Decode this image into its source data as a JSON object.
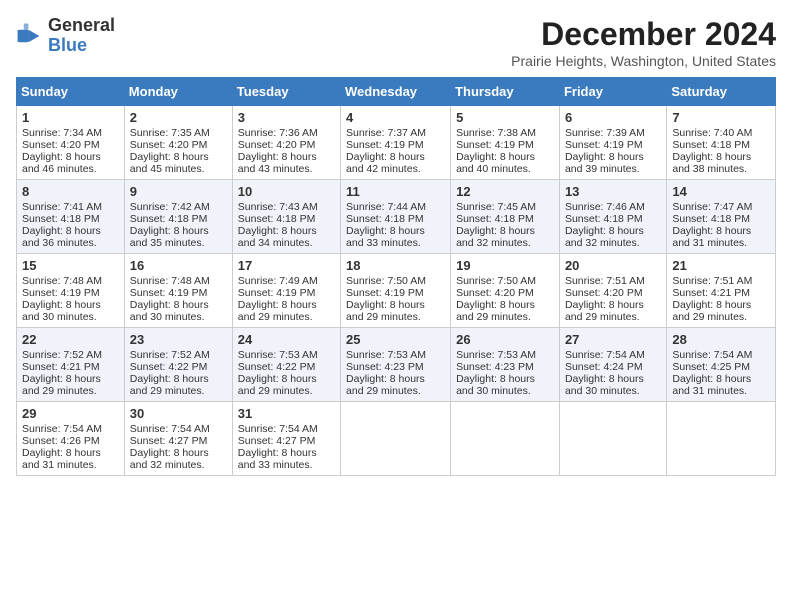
{
  "app": {
    "name_line1": "General",
    "name_line2": "Blue"
  },
  "header": {
    "month": "December 2024",
    "location": "Prairie Heights, Washington, United States"
  },
  "weekdays": [
    "Sunday",
    "Monday",
    "Tuesday",
    "Wednesday",
    "Thursday",
    "Friday",
    "Saturday"
  ],
  "weeks": [
    [
      {
        "day": 1,
        "sunrise": "7:34 AM",
        "sunset": "4:20 PM",
        "daylight": "8 hours and 46 minutes."
      },
      {
        "day": 2,
        "sunrise": "7:35 AM",
        "sunset": "4:20 PM",
        "daylight": "8 hours and 45 minutes."
      },
      {
        "day": 3,
        "sunrise": "7:36 AM",
        "sunset": "4:20 PM",
        "daylight": "8 hours and 43 minutes."
      },
      {
        "day": 4,
        "sunrise": "7:37 AM",
        "sunset": "4:19 PM",
        "daylight": "8 hours and 42 minutes."
      },
      {
        "day": 5,
        "sunrise": "7:38 AM",
        "sunset": "4:19 PM",
        "daylight": "8 hours and 40 minutes."
      },
      {
        "day": 6,
        "sunrise": "7:39 AM",
        "sunset": "4:19 PM",
        "daylight": "8 hours and 39 minutes."
      },
      {
        "day": 7,
        "sunrise": "7:40 AM",
        "sunset": "4:18 PM",
        "daylight": "8 hours and 38 minutes."
      }
    ],
    [
      {
        "day": 8,
        "sunrise": "7:41 AM",
        "sunset": "4:18 PM",
        "daylight": "8 hours and 36 minutes."
      },
      {
        "day": 9,
        "sunrise": "7:42 AM",
        "sunset": "4:18 PM",
        "daylight": "8 hours and 35 minutes."
      },
      {
        "day": 10,
        "sunrise": "7:43 AM",
        "sunset": "4:18 PM",
        "daylight": "8 hours and 34 minutes."
      },
      {
        "day": 11,
        "sunrise": "7:44 AM",
        "sunset": "4:18 PM",
        "daylight": "8 hours and 33 minutes."
      },
      {
        "day": 12,
        "sunrise": "7:45 AM",
        "sunset": "4:18 PM",
        "daylight": "8 hours and 32 minutes."
      },
      {
        "day": 13,
        "sunrise": "7:46 AM",
        "sunset": "4:18 PM",
        "daylight": "8 hours and 32 minutes."
      },
      {
        "day": 14,
        "sunrise": "7:47 AM",
        "sunset": "4:18 PM",
        "daylight": "8 hours and 31 minutes."
      }
    ],
    [
      {
        "day": 15,
        "sunrise": "7:48 AM",
        "sunset": "4:19 PM",
        "daylight": "8 hours and 30 minutes."
      },
      {
        "day": 16,
        "sunrise": "7:48 AM",
        "sunset": "4:19 PM",
        "daylight": "8 hours and 30 minutes."
      },
      {
        "day": 17,
        "sunrise": "7:49 AM",
        "sunset": "4:19 PM",
        "daylight": "8 hours and 29 minutes."
      },
      {
        "day": 18,
        "sunrise": "7:50 AM",
        "sunset": "4:19 PM",
        "daylight": "8 hours and 29 minutes."
      },
      {
        "day": 19,
        "sunrise": "7:50 AM",
        "sunset": "4:20 PM",
        "daylight": "8 hours and 29 minutes."
      },
      {
        "day": 20,
        "sunrise": "7:51 AM",
        "sunset": "4:20 PM",
        "daylight": "8 hours and 29 minutes."
      },
      {
        "day": 21,
        "sunrise": "7:51 AM",
        "sunset": "4:21 PM",
        "daylight": "8 hours and 29 minutes."
      }
    ],
    [
      {
        "day": 22,
        "sunrise": "7:52 AM",
        "sunset": "4:21 PM",
        "daylight": "8 hours and 29 minutes."
      },
      {
        "day": 23,
        "sunrise": "7:52 AM",
        "sunset": "4:22 PM",
        "daylight": "8 hours and 29 minutes."
      },
      {
        "day": 24,
        "sunrise": "7:53 AM",
        "sunset": "4:22 PM",
        "daylight": "8 hours and 29 minutes."
      },
      {
        "day": 25,
        "sunrise": "7:53 AM",
        "sunset": "4:23 PM",
        "daylight": "8 hours and 29 minutes."
      },
      {
        "day": 26,
        "sunrise": "7:53 AM",
        "sunset": "4:23 PM",
        "daylight": "8 hours and 30 minutes."
      },
      {
        "day": 27,
        "sunrise": "7:54 AM",
        "sunset": "4:24 PM",
        "daylight": "8 hours and 30 minutes."
      },
      {
        "day": 28,
        "sunrise": "7:54 AM",
        "sunset": "4:25 PM",
        "daylight": "8 hours and 31 minutes."
      }
    ],
    [
      {
        "day": 29,
        "sunrise": "7:54 AM",
        "sunset": "4:26 PM",
        "daylight": "8 hours and 31 minutes."
      },
      {
        "day": 30,
        "sunrise": "7:54 AM",
        "sunset": "4:27 PM",
        "daylight": "8 hours and 32 minutes."
      },
      {
        "day": 31,
        "sunrise": "7:54 AM",
        "sunset": "4:27 PM",
        "daylight": "8 hours and 33 minutes."
      },
      null,
      null,
      null,
      null
    ]
  ]
}
